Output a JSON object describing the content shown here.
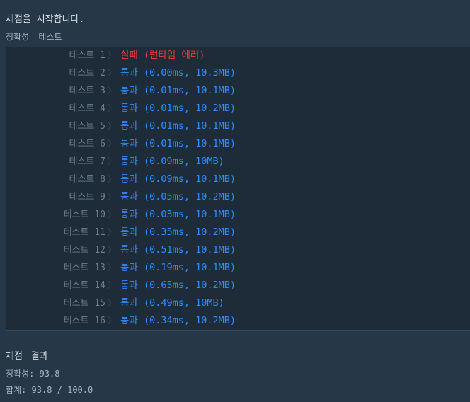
{
  "header": {
    "start_message": "채점을 시작합니다.",
    "section_label": "정확성  테스트"
  },
  "tests": [
    {
      "name": "테스트 1",
      "result": "실패 (런타임 에러)",
      "status": "fail"
    },
    {
      "name": "테스트 2",
      "result": "통과 (0.00ms, 10.3MB)",
      "status": "pass"
    },
    {
      "name": "테스트 3",
      "result": "통과 (0.01ms, 10.1MB)",
      "status": "pass"
    },
    {
      "name": "테스트 4",
      "result": "통과 (0.01ms, 10.2MB)",
      "status": "pass"
    },
    {
      "name": "테스트 5",
      "result": "통과 (0.01ms, 10.1MB)",
      "status": "pass"
    },
    {
      "name": "테스트 6",
      "result": "통과 (0.01ms, 10.1MB)",
      "status": "pass"
    },
    {
      "name": "테스트 7",
      "result": "통과 (0.09ms, 10MB)",
      "status": "pass"
    },
    {
      "name": "테스트 8",
      "result": "통과 (0.09ms, 10.1MB)",
      "status": "pass"
    },
    {
      "name": "테스트 9",
      "result": "통과 (0.05ms, 10.2MB)",
      "status": "pass"
    },
    {
      "name": "테스트 10",
      "result": "통과 (0.03ms, 10.1MB)",
      "status": "pass"
    },
    {
      "name": "테스트 11",
      "result": "통과 (0.35ms, 10.2MB)",
      "status": "pass"
    },
    {
      "name": "테스트 12",
      "result": "통과 (0.51ms, 10.1MB)",
      "status": "pass"
    },
    {
      "name": "테스트 13",
      "result": "통과 (0.19ms, 10.1MB)",
      "status": "pass"
    },
    {
      "name": "테스트 14",
      "result": "통과 (0.65ms, 10.2MB)",
      "status": "pass"
    },
    {
      "name": "테스트 15",
      "result": "통과 (0.49ms, 10MB)",
      "status": "pass"
    },
    {
      "name": "테스트 16",
      "result": "통과 (0.34ms, 10.2MB)",
      "status": "pass"
    }
  ],
  "summary": {
    "title": "채점 결과",
    "accuracy": "정확성: 93.8",
    "total": "합계: 93.8 / 100.0"
  },
  "colors": {
    "background": "#263747",
    "panel": "#1e2b38",
    "pass": "#2f8cff",
    "fail": "#ee3a3a",
    "muted": "#6e7f8f"
  },
  "icons": {
    "row_separator": "chevron-right-icon"
  }
}
